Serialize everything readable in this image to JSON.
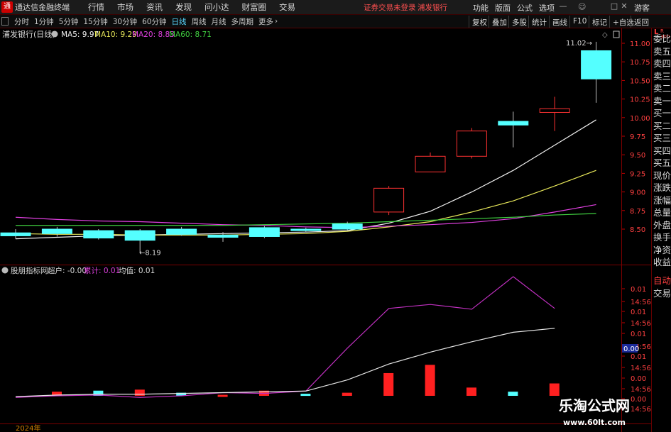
{
  "app": {
    "logo": "通",
    "title": "通达信金融终端"
  },
  "main_menu": [
    "行情",
    "市场",
    "资讯",
    "发现",
    "问小达",
    "财富圈",
    "交易"
  ],
  "status": {
    "login": "证券交易未登录",
    "stock": "浦发银行"
  },
  "right_menu": [
    "功能",
    "版面",
    "公式",
    "选项",
    "游客"
  ],
  "window_buttons": [
    "—",
    "□",
    "✕"
  ],
  "period_tabs": [
    "分时",
    "1分钟",
    "5分钟",
    "15分钟",
    "30分钟",
    "60分钟",
    "日线",
    "周线",
    "月线",
    "多周期",
    "更多"
  ],
  "active_tab": "日线",
  "right_tools": [
    "复权",
    "叠加",
    "多股",
    "统计",
    "画线",
    "F10",
    "标记",
    "+自选",
    "返回"
  ],
  "main_chart": {
    "stock_title": "浦发银行(日线)",
    "ma": [
      {
        "label": "MA5: 9.97",
        "color": "#f0f0f0"
      },
      {
        "label": "MA10: 9.29",
        "color": "#e8e85a"
      },
      {
        "label": "MA20: 8.83",
        "color": "#e040e0"
      },
      {
        "label": "MA60: 8.71",
        "color": "#40d040"
      }
    ],
    "price_ticks": [
      "11.00",
      "10.75",
      "10.50",
      "10.25",
      "10.00",
      "9.75",
      "9.50",
      "9.25",
      "9.00",
      "8.75",
      "8.50"
    ],
    "low_label": "8.19",
    "high_label": "11.02",
    "candles": [
      {
        "o": 8.45,
        "c": 8.41,
        "h": 8.5,
        "l": 8.37
      },
      {
        "o": 8.5,
        "c": 8.44,
        "h": 8.53,
        "l": 8.4
      },
      {
        "o": 8.48,
        "c": 8.38,
        "h": 8.5,
        "l": 8.36
      },
      {
        "o": 8.48,
        "c": 8.35,
        "h": 8.5,
        "l": 8.19
      },
      {
        "o": 8.5,
        "c": 8.43,
        "h": 8.53,
        "l": 8.41
      },
      {
        "o": 8.42,
        "c": 8.39,
        "h": 8.46,
        "l": 8.33
      },
      {
        "o": 8.52,
        "c": 8.4,
        "h": 8.54,
        "l": 8.38
      },
      {
        "o": 8.5,
        "c": 8.48,
        "h": 8.52,
        "l": 8.46
      },
      {
        "o": 8.57,
        "c": 8.5,
        "h": 8.6,
        "l": 8.48
      },
      {
        "o": 8.73,
        "c": 9.05,
        "h": 9.08,
        "l": 8.69
      },
      {
        "o": 9.27,
        "c": 9.48,
        "h": 9.53,
        "l": 9.27
      },
      {
        "o": 9.48,
        "c": 9.82,
        "h": 9.86,
        "l": 9.45
      },
      {
        "o": 9.95,
        "c": 9.9,
        "h": 10.08,
        "l": 9.6
      },
      {
        "o": 10.07,
        "c": 10.12,
        "h": 10.28,
        "l": 9.82
      },
      {
        "o": 10.9,
        "c": 10.52,
        "h": 11.02,
        "l": 10.2
      }
    ],
    "ma_series": {
      "ma5": [
        8.37,
        8.39,
        8.41,
        8.42,
        8.43,
        8.44,
        8.45,
        8.46,
        8.48,
        8.58,
        8.74,
        9.0,
        9.29,
        9.63,
        9.97
      ],
      "ma10": [
        8.44,
        8.43,
        8.43,
        8.42,
        8.42,
        8.42,
        8.43,
        8.44,
        8.47,
        8.53,
        8.6,
        8.73,
        8.88,
        9.08,
        9.29
      ],
      "ma20": [
        8.66,
        8.63,
        8.61,
        8.6,
        8.58,
        8.56,
        8.55,
        8.53,
        8.52,
        8.54,
        8.56,
        8.59,
        8.64,
        8.73,
        8.83
      ],
      "ma60": [
        8.55,
        8.55,
        8.55,
        8.55,
        8.55,
        8.55,
        8.56,
        8.57,
        8.58,
        8.6,
        8.62,
        8.64,
        8.66,
        8.69,
        8.71
      ]
    }
  },
  "indicator": {
    "name": "股朋指标网",
    "super_label": "超户: -0.00",
    "cum_label": "累计: 0.01",
    "avg_label": "均值: 0.01",
    "ticks": [
      "0.01",
      "14:56",
      "0.01",
      "14:56",
      "0.01",
      "14:56",
      "0.01",
      "14:56",
      "0.00",
      "14:56",
      "0.00",
      "14:56"
    ],
    "current_value": "0.00",
    "bars": [
      0.0004,
      -0.0005,
      0.0006,
      -0.0003,
      0.0001,
      0.0005,
      -0.0002,
      0.0003,
      0.0022,
      0.003,
      0.0008,
      -0.0004,
      0.0012
    ],
    "purple": [
      -0.0002,
      0.0,
      0.0001,
      -0.0002,
      0.0,
      0.0004,
      0.0003,
      0.0006,
      0.006,
      0.011,
      0.0115,
      0.0109,
      0.015,
      0.011
    ],
    "white": [
      -0.0001,
      0.0001,
      0.0002,
      0.0002,
      0.0003,
      0.0004,
      0.0005,
      0.0006,
      0.002,
      0.004,
      0.0055,
      0.0068,
      0.008,
      0.0085
    ]
  },
  "year_label": "2024年",
  "sidebar": [
    "委比",
    "卖五",
    "卖四",
    "卖三",
    "卖二",
    "卖一",
    "买一",
    "买二",
    "买三",
    "买四",
    "买五",
    "现价",
    "涨跌",
    "涨幅",
    "总量",
    "外盘",
    "换手",
    "净资",
    "收益",
    "自动",
    "交易"
  ],
  "watermark": {
    "title": "乐淘公式网",
    "url": "www.60lt.com"
  },
  "colors": {
    "up": "#ff3232",
    "down": "#54ffff",
    "ma5": "#f0f0f0",
    "ma10": "#e8e85a",
    "ma20": "#e040e0",
    "ma60": "#40d040",
    "border": "#7a0000"
  }
}
